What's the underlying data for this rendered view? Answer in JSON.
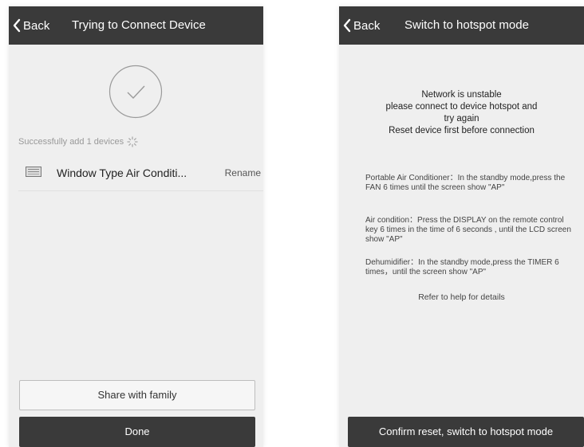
{
  "left_screen": {
    "back_label": "Back",
    "title": "Trying to Connect Device",
    "success_text": "Successfully add 1 devices",
    "device": {
      "name": "Window Type Air Conditi...",
      "rename_label": "Rename"
    },
    "share_button": "Share with family",
    "done_button": "Done"
  },
  "right_screen": {
    "back_label": "Back",
    "title": "Switch to hotspot mode",
    "network_message": [
      "Network is unstable",
      "please connect to device hotspot and",
      "try again",
      "Reset device first before connection"
    ],
    "instructions": [
      "Portable Air Conditioner：In the standby mode,press the FAN 6 times until the screen show \"AP\"",
      "Air condition：Press the DISPLAY on the remote control key 6 times in the time of 6 seconds , until the LCD screen show \"AP\"",
      "Dehumidifier：In the standby mode,press the TIMER 6 times，until the screen show \"AP\""
    ],
    "help_text": "Refer to help for details",
    "confirm_button": "Confirm reset, switch to hotspot mode"
  },
  "icons": {
    "back": "chevron-left-icon",
    "success": "checkmark-circle-icon",
    "loading": "spinner-icon",
    "device": "air-conditioner-icon"
  },
  "colors": {
    "navbar": "#3a3a3a",
    "screen_background": "#efefef",
    "primary_button": "#3a3a3a"
  }
}
